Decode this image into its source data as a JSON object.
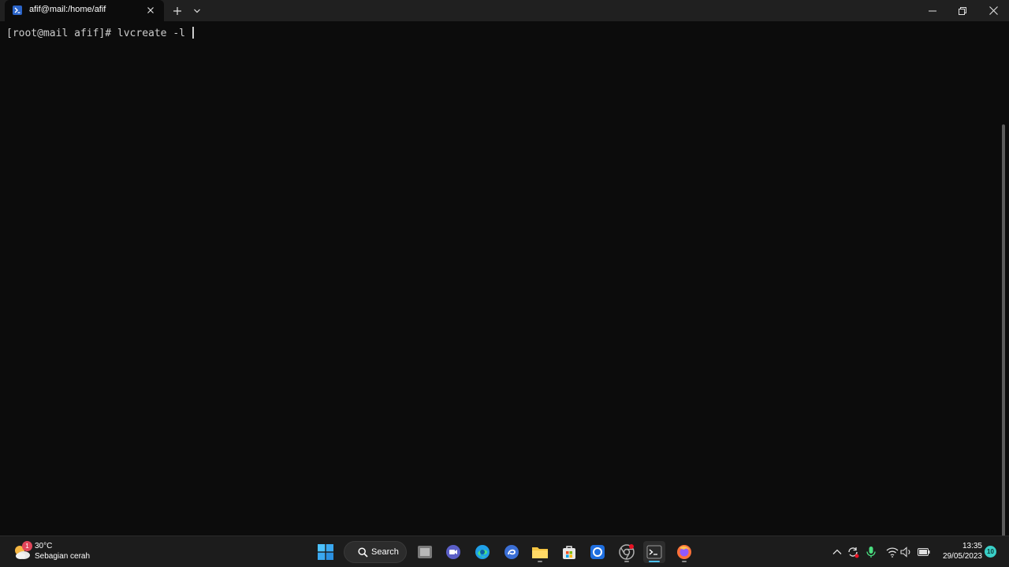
{
  "window": {
    "tab_title": "afif@mail:/home/afif"
  },
  "terminal": {
    "prompt": "[root@mail afif]# ",
    "command": "lvcreate -l "
  },
  "taskbar": {
    "weather": {
      "temperature": "30°C",
      "description": "Sebagian cerah",
      "badge": "1"
    },
    "search_label": "Search",
    "clock": {
      "time": "13:35",
      "date": "29/05/2023"
    },
    "notification_count": "10",
    "apps": [
      "start-icon",
      "task-view-icon",
      "chat-icon",
      "edge-icon",
      "browser-icon",
      "file-explorer-icon",
      "store-icon",
      "app-icon",
      "chrome-icon",
      "terminal-icon",
      "firefox-icon"
    ]
  },
  "colors": {
    "terminal_bg": "#0c0c0c",
    "titlebar_bg": "#202020",
    "taskbar_bg": "#1c1c1c",
    "accent": "#4cc2ff"
  }
}
